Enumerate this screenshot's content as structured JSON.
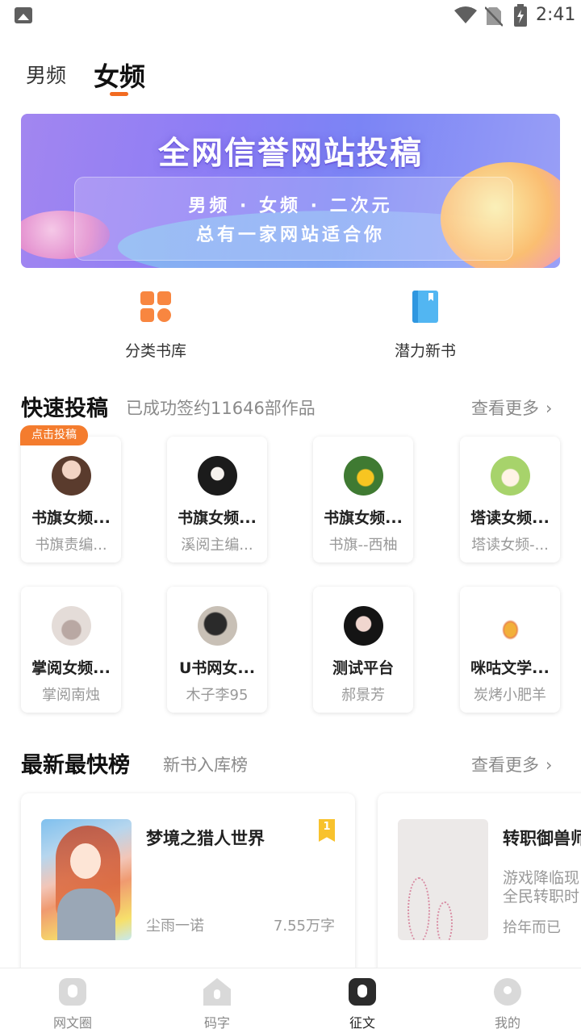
{
  "status_bar": {
    "time": "2:41"
  },
  "tabs": [
    {
      "label": "男频",
      "selected": false
    },
    {
      "label": "女频",
      "selected": true
    }
  ],
  "banner": {
    "headline": "全网信誉网站投稿",
    "line1": "男频 · 女频 · 二次元",
    "line2": "总有一家网站适合你"
  },
  "entries": [
    {
      "label": "分类书库",
      "icon": "grid-icon"
    },
    {
      "label": "潜力新书",
      "icon": "book-icon"
    }
  ],
  "quick_submit": {
    "title": "快速投稿",
    "subtitle": "已成功签约11646部作品",
    "more": "查看更多",
    "badge": "点击投稿",
    "cards": [
      {
        "name": "书旗女频...",
        "sub": "书旗责编..."
      },
      {
        "name": "书旗女频...",
        "sub": "溪阅主编..."
      },
      {
        "name": "书旗女频...",
        "sub": "书旗--西柚"
      },
      {
        "name": "塔读女频...",
        "sub": "塔读女频-..."
      },
      {
        "name": "掌阅女频...",
        "sub": "掌阅南烛"
      },
      {
        "name": "U书网女...",
        "sub": "木子李95"
      },
      {
        "name": "测试平台",
        "sub": "郝景芳"
      },
      {
        "name": "咪咕文学...",
        "sub": "炭烤小肥羊"
      }
    ]
  },
  "ranking": {
    "title": "最新最快榜",
    "subtitle": "新书入库榜",
    "more": "查看更多",
    "books": [
      {
        "title": "梦境之猎人世界",
        "author": "尘雨一诺",
        "words": "7.55万字",
        "rank": "1"
      },
      {
        "title": "转职御兽师",
        "desc1": "游戏降临现",
        "desc2": "全民转职时",
        "author": "拾年而已"
      }
    ]
  },
  "bottom_nav": [
    {
      "label": "网文圈",
      "active": false
    },
    {
      "label": "码字",
      "active": false
    },
    {
      "label": "征文",
      "active": true
    },
    {
      "label": "我的",
      "active": false
    }
  ],
  "colors": {
    "accent": "#f26b21",
    "badge": "#f47c2e",
    "rank_flag": "#f8c22d"
  }
}
